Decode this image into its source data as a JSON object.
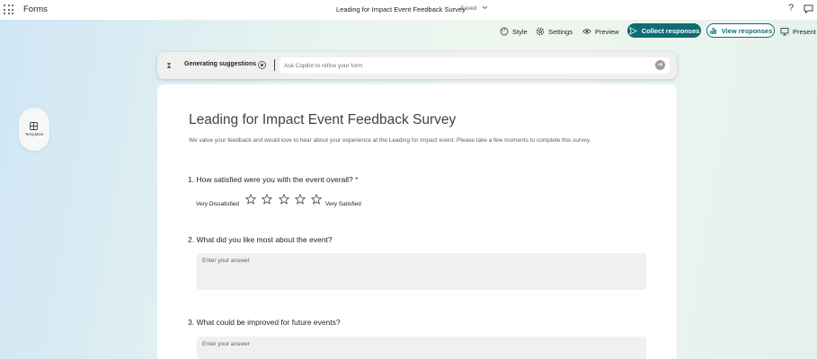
{
  "app": {
    "name": "Forms"
  },
  "doc": {
    "title": "Leading for Impact Event Feedback Survey",
    "status": "Saved"
  },
  "toolbar": {
    "style_label": "Style",
    "settings_label": "Settings",
    "preview_label": "Preview",
    "collect_label": "Collect responses",
    "view_label": "View responses",
    "present_label": "Present"
  },
  "copilot": {
    "status": "Generating suggestions",
    "placeholder": "Ask Copilot to refine your form"
  },
  "sidebar": {
    "templates_label": "Templates"
  },
  "form": {
    "title": "Leading for Impact Event Feedback Survey",
    "description": "We value your feedback and would love to hear about your experience at the Leading for Impact event. Please take a few moments to complete this survey.",
    "questions": [
      {
        "text": "1. How satisfied were you with the event overall?",
        "required_mark": "*",
        "type": "rating",
        "stars": 5,
        "rating": 0,
        "low_label": "Very Dissatisfied",
        "high_label": "Very Satisfied"
      },
      {
        "text": "2. What did you like most about the event?",
        "type": "text",
        "placeholder": "Enter your answer"
      },
      {
        "text": "3. What could be improved for future events?",
        "type": "text",
        "placeholder": "Enter your answer"
      }
    ]
  },
  "colors": {
    "accent": "#0f6b74",
    "required": "#c50f1f"
  }
}
